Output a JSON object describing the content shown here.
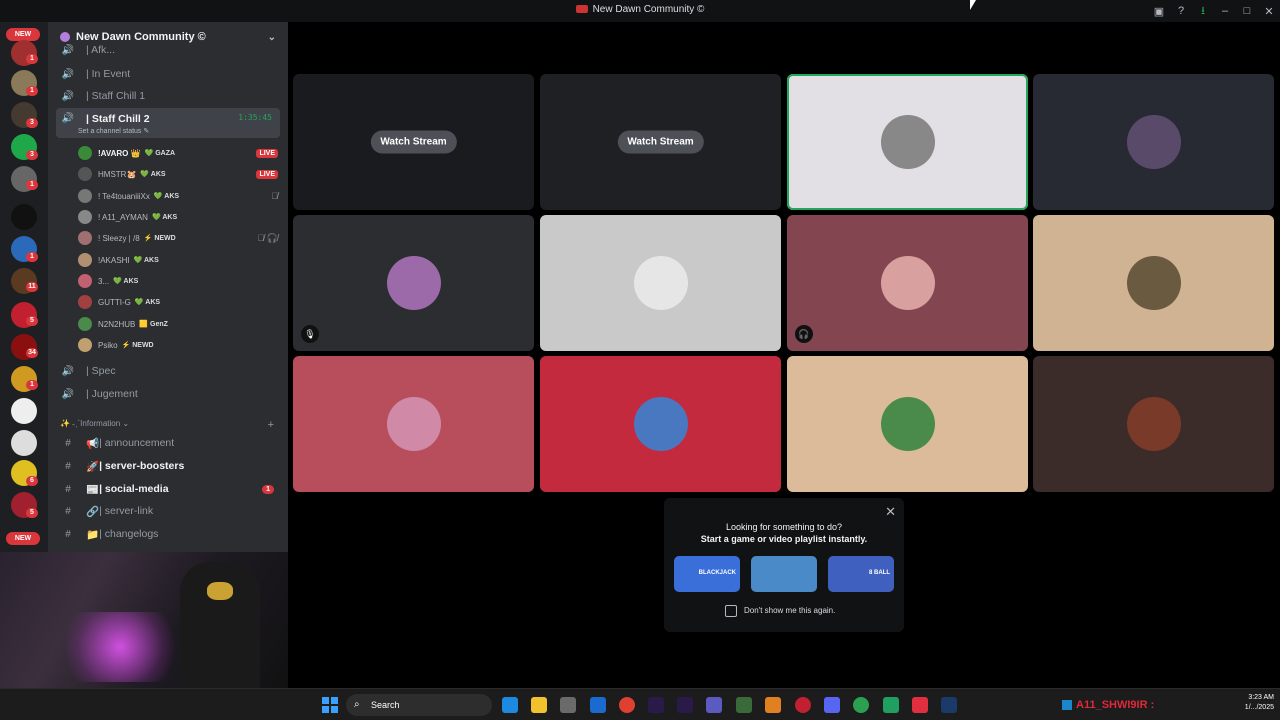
{
  "window": {
    "title": "New Dawn Community ©"
  },
  "server_rail": {
    "new_badge_top": "NEW",
    "new_badge_bottom": "NEW",
    "badges": [
      "1",
      "1",
      "1",
      "3",
      "3",
      "1",
      "1",
      "11",
      "5",
      "34",
      "1",
      "6",
      "5"
    ]
  },
  "server": {
    "name": "New Dawn Community ©",
    "chevron": "⌄"
  },
  "channels": {
    "cut_top": "| Afk...",
    "voice_in_event": "| In Event",
    "voice_staff_chill_1": "| Staff Chill 1",
    "voice_staff_chill_2": "| Staff Chill 2",
    "staff_chill_2_timer": "1:35:45",
    "staff_chill_2_status": "Set a channel status ✎",
    "voice_spec": "| Spec",
    "voice_jugement": "| Jugement"
  },
  "voice_users": [
    {
      "name": "!AVARO 👑",
      "tag": "💚 GAZA",
      "live": "LIVE"
    },
    {
      "name": "HMSTR🐹",
      "tag": "💚 AKS",
      "live": "LIVE"
    },
    {
      "name": "! Te4touaniiiXx",
      "tag": "💚 AKS",
      "icons": "🎙̸"
    },
    {
      "name": "! A11_AYMAN",
      "tag": "💚 AKS"
    },
    {
      "name": "! Sleezy | /8",
      "tag": "⚡ NEWD",
      "icons": "🎙̸ 🎧̸"
    },
    {
      "name": "!AKASHI",
      "tag": "💚 AKS"
    },
    {
      "name": "3...",
      "tag": "💚 AKS"
    },
    {
      "name": "GUTTI-G",
      "tag": "💚 AKS"
    },
    {
      "name": "N2N2HUB",
      "tag": "🟨 GenZ"
    },
    {
      "name": "Psiko",
      "tag": "⚡ NEWD"
    }
  ],
  "category": {
    "label": "✨ ˗ˏˋInformation ⌄",
    "plus": "+"
  },
  "text_channels": [
    {
      "label": "| announcement",
      "icon": "📢",
      "bold": false
    },
    {
      "label": "| server-boosters",
      "icon": "🚀",
      "bold": true
    },
    {
      "label": "| social-media",
      "icon": "📰",
      "bold": true,
      "badge": "1"
    },
    {
      "label": "| server-link",
      "icon": "🔗",
      "bold": false
    },
    {
      "label": "| changelogs",
      "icon": "📁",
      "bold": false
    }
  ],
  "stage": {
    "watch_stream_label": "Watch Stream",
    "tiles": [
      {
        "kind": "stream",
        "bg": "#1a1b1e"
      },
      {
        "kind": "stream",
        "bg": "#1f2023"
      },
      {
        "kind": "avatar",
        "bg": "#e2e0e4",
        "speaking": true,
        "avatar_color": "#888"
      },
      {
        "kind": "avatar",
        "bg": "#272a33",
        "avatar_color": "#5a4a6a"
      },
      {
        "kind": "avatar",
        "bg": "#2b2d31",
        "avatar_color": "#9c6aa8",
        "muted": "🎙"
      },
      {
        "kind": "avatar",
        "bg": "#c9c9c9",
        "avatar_color": "#e6e6e6"
      },
      {
        "kind": "avatar",
        "bg": "#834650",
        "avatar_color": "#d9a0a0",
        "muted": "🎧"
      },
      {
        "kind": "avatar",
        "bg": "#d0b393",
        "avatar_color": "#6a5a40"
      },
      {
        "kind": "avatar",
        "bg": "#b84e5c",
        "avatar_color": "#d08aa8"
      },
      {
        "kind": "avatar",
        "bg": "#c42a3e",
        "avatar_color": "#4a78c0"
      },
      {
        "kind": "avatar",
        "bg": "#dcbb9b",
        "avatar_color": "#4a8a4a"
      },
      {
        "kind": "avatar",
        "bg": "#3b2b29",
        "avatar_color": "#7a3a2a"
      }
    ]
  },
  "activity_popup": {
    "line1": "Looking for something to do?",
    "line2": "Start a game or video playlist instantly.",
    "activities": [
      {
        "label": "BLACKJACK",
        "color": "#3a6ed8"
      },
      {
        "label": "",
        "color": "#4a8ac8"
      },
      {
        "label": "8 BALL",
        "color": "#4060c0"
      }
    ],
    "dont_show": "Don't show me this again.",
    "close": "✕"
  },
  "taskbar": {
    "search_placeholder": "Search",
    "clock_time": "3:23 AM",
    "clock_date": "1/.../2025",
    "overlay_text": "A11_SHWI9IR :"
  }
}
